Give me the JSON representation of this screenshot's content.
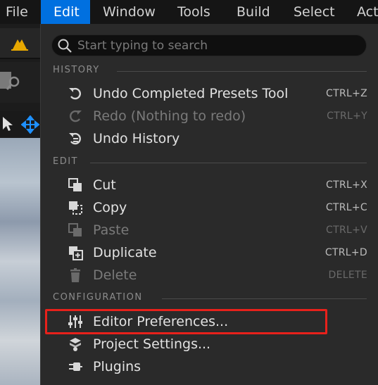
{
  "menubar": {
    "items": [
      {
        "label": "File"
      },
      {
        "label": "Edit"
      },
      {
        "label": "Window"
      },
      {
        "label": "Tools"
      },
      {
        "label": "Build"
      },
      {
        "label": "Select"
      },
      {
        "label": "Act"
      }
    ],
    "active": "Edit"
  },
  "colors": {
    "accent": "#0070e0",
    "highlight_box": "#e8211b",
    "menu_bg": "#2a2a2a",
    "warning_icon": "#e8a800"
  },
  "search": {
    "placeholder": "Start typing to search",
    "value": ""
  },
  "sections": {
    "history": {
      "title": "HISTORY",
      "items": [
        {
          "label": "Undo Completed Presets Tool",
          "shortcut": "CTRL+Z",
          "icon": "undo-icon",
          "enabled": true
        },
        {
          "label": "Redo (Nothing to redo)",
          "shortcut": "CTRL+Y",
          "icon": "redo-icon",
          "enabled": false
        },
        {
          "label": "Undo History",
          "shortcut": "",
          "icon": "undo-history-icon",
          "enabled": true
        }
      ]
    },
    "edit": {
      "title": "EDIT",
      "items": [
        {
          "label": "Cut",
          "shortcut": "CTRL+X",
          "icon": "cut-icon",
          "enabled": true
        },
        {
          "label": "Copy",
          "shortcut": "CTRL+C",
          "icon": "copy-icon",
          "enabled": true
        },
        {
          "label": "Paste",
          "shortcut": "CTRL+V",
          "icon": "paste-icon",
          "enabled": false
        },
        {
          "label": "Duplicate",
          "shortcut": "CTRL+D",
          "icon": "duplicate-icon",
          "enabled": true
        },
        {
          "label": "Delete",
          "shortcut": "DELETE",
          "icon": "trash-icon",
          "enabled": false
        }
      ]
    },
    "configuration": {
      "title": "CONFIGURATION",
      "items": [
        {
          "label": "Editor Preferences...",
          "shortcut": "",
          "icon": "sliders-icon",
          "enabled": true
        },
        {
          "label": "Project Settings...",
          "shortcut": "",
          "icon": "project-settings-icon",
          "enabled": true
        },
        {
          "label": "Plugins",
          "shortcut": "",
          "icon": "plugin-icon",
          "enabled": true
        }
      ]
    }
  }
}
